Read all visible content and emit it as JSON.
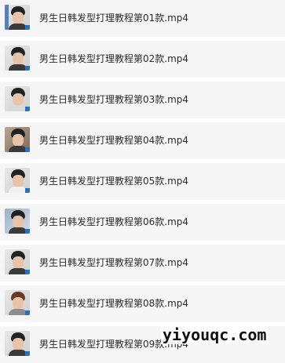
{
  "files": [
    {
      "name": "男生日韩发型打理教程第01款.mp4",
      "icon": "video-thumbnail-icon"
    },
    {
      "name": "男生日韩发型打理教程第02款.mp4",
      "icon": "video-thumbnail-icon"
    },
    {
      "name": "男生日韩发型打理教程第03款.mp4",
      "icon": "video-thumbnail-icon"
    },
    {
      "name": "男生日韩发型打理教程第04款.mp4",
      "icon": "video-thumbnail-icon"
    },
    {
      "name": "男生日韩发型打理教程第05款.mp4",
      "icon": "video-thumbnail-icon"
    },
    {
      "name": "男生日韩发型打理教程第06款.mp4",
      "icon": "video-thumbnail-icon"
    },
    {
      "name": "男生日韩发型打理教程第07款.mp4",
      "icon": "video-thumbnail-icon"
    },
    {
      "name": "男生日韩发型打理教程第08款.mp4",
      "icon": "video-thumbnail-icon"
    },
    {
      "name": "男生日韩发型打理教程第09款.mp4",
      "icon": "video-thumbnail-icon"
    }
  ],
  "watermark": "yiyouqc.com",
  "colors": {
    "row_background": "#f5f5f6",
    "text": "#2b2b2b",
    "thumb_accent": "#2d6fb8"
  }
}
